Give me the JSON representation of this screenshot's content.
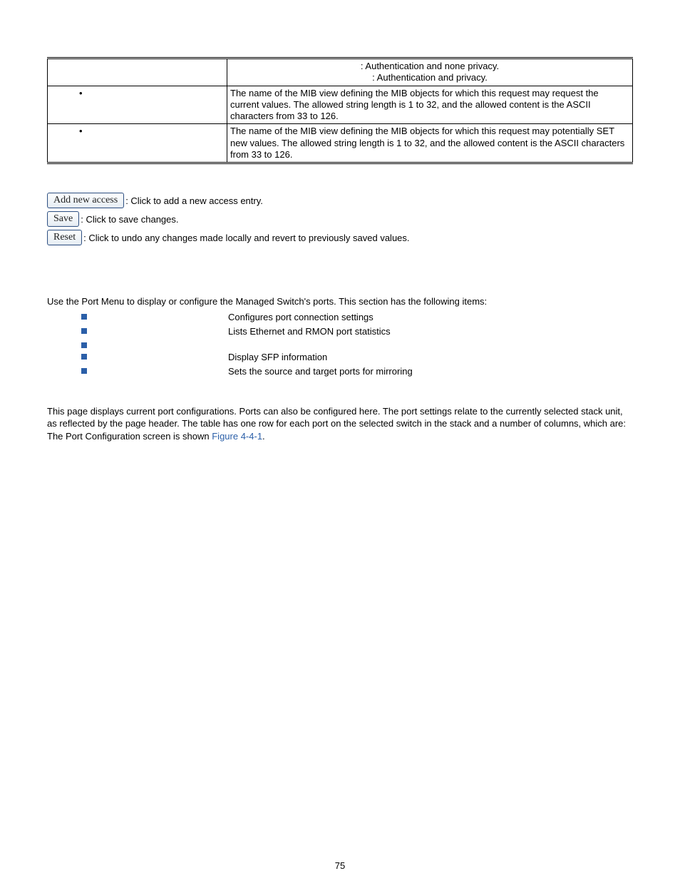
{
  "table": {
    "rows": [
      {
        "label": "",
        "desc_l1": ": Authentication and none privacy.",
        "desc_l2": ": Authentication and privacy."
      },
      {
        "label": "",
        "desc": "The name of the MIB view defining the MIB objects for which this request may request the current values. The allowed string length is 1 to 32, and the allowed content is the ASCII characters from 33 to 126."
      },
      {
        "label": "",
        "desc": "The name of the MIB view defining the MIB objects for which this request may potentially SET new values. The allowed string length is 1 to 32, and the allowed content is the ASCII characters from 33 to 126."
      }
    ]
  },
  "buttons": [
    {
      "label": "Add new access",
      "desc": ": Click to add a new access entry."
    },
    {
      "label": "Save",
      "desc": ": Click to save changes."
    },
    {
      "label": "Reset",
      "desc": ": Click to undo any changes made locally and revert to previously saved values."
    }
  ],
  "section": {
    "intro": "Use the Port Menu to display or configure the Managed Switch's ports. This section has the following items:",
    "items": [
      {
        "desc": "Configures port connection settings"
      },
      {
        "desc": "Lists Ethernet and RMON port statistics"
      },
      {
        "desc": ""
      },
      {
        "desc": "Display SFP information"
      },
      {
        "desc": "Sets the source and target ports for mirroring"
      }
    ]
  },
  "paragraph": {
    "p1": "This page displays current port configurations. Ports can also be configured here. The port settings relate to the currently selected stack unit, as reflected by the page header. The table has one row for each port on the selected switch in the stack and a number of columns, which are:",
    "p2a": "The Port Configuration screen is shown ",
    "p2_link": "Figure 4-4-1",
    "p2b": "."
  },
  "footer": {
    "pagenum": "75"
  }
}
